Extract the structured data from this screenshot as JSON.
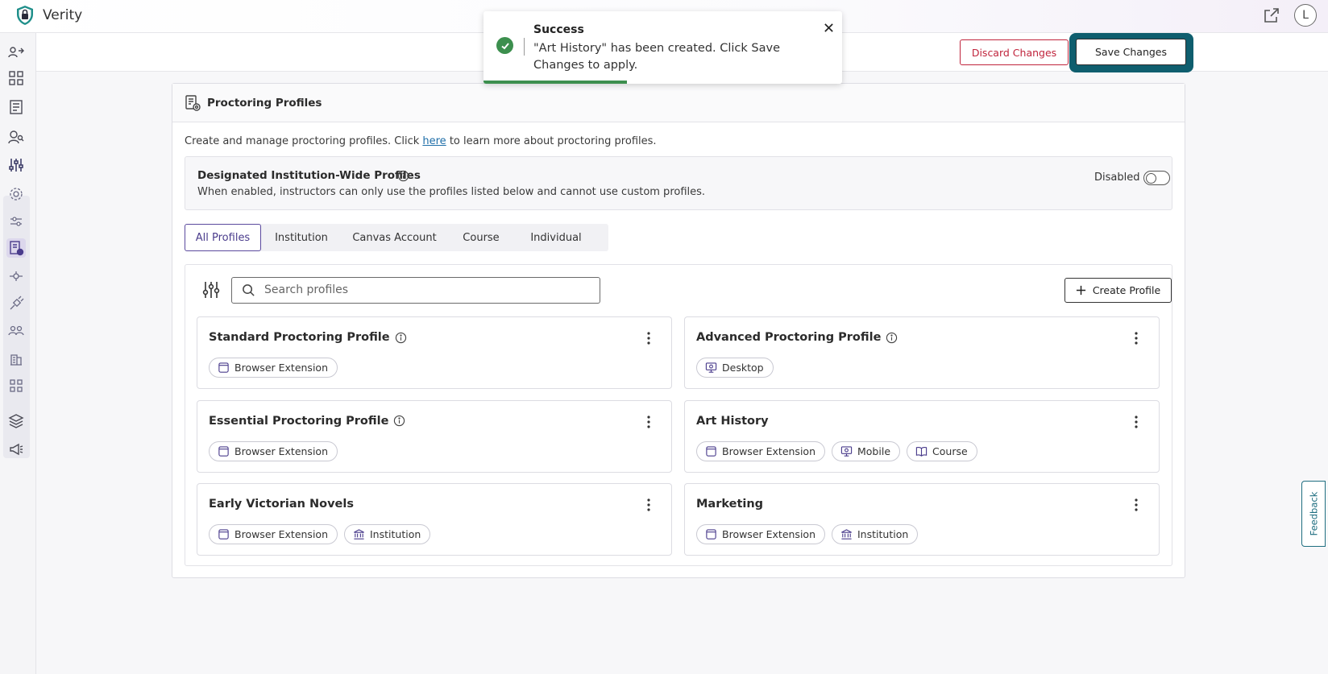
{
  "app": {
    "name": "Verity",
    "avatar_initial": "L"
  },
  "actions": {
    "discard_label": "Discard Changes",
    "save_label": "Save Changes"
  },
  "toast": {
    "title": "Success",
    "message": "\"Art History\" has been created. Click Save Changes to apply.",
    "progress": 0.4
  },
  "page": {
    "title": "Proctoring Profiles",
    "intro_before": "Create and manage proctoring profiles. Click ",
    "intro_link": "here",
    "intro_after": " to learn more about proctoring profiles."
  },
  "designated": {
    "title": "Designated Institution-Wide Profiles",
    "description": "When enabled, instructors can only use the profiles listed below and cannot use custom profiles.",
    "toggle_label": "Disabled",
    "enabled": false
  },
  "tabs": [
    {
      "label": "All Profiles",
      "active": true
    },
    {
      "label": "Institution",
      "active": false
    },
    {
      "label": "Canvas Account",
      "active": false
    },
    {
      "label": "Course",
      "active": false
    },
    {
      "label": "Individual",
      "active": false
    }
  ],
  "search": {
    "placeholder": "Search profiles"
  },
  "create_label": "Create Profile",
  "profiles": [
    {
      "name": "Standard Proctoring Profile",
      "info": true,
      "tags": [
        {
          "label": "Browser Extension",
          "icon": "browser-extension-icon"
        }
      ]
    },
    {
      "name": "Advanced Proctoring Profile",
      "info": true,
      "tags": [
        {
          "label": "Desktop",
          "icon": "desktop-icon"
        }
      ]
    },
    {
      "name": "Essential Proctoring Profile",
      "info": true,
      "tags": [
        {
          "label": "Browser Extension",
          "icon": "browser-extension-icon"
        }
      ]
    },
    {
      "name": "Art History",
      "info": false,
      "tags": [
        {
          "label": "Browser Extension",
          "icon": "browser-extension-icon"
        },
        {
          "label": "Mobile",
          "icon": "mobile-icon"
        },
        {
          "label": "Course",
          "icon": "course-icon"
        }
      ]
    },
    {
      "name": "Early Victorian Novels",
      "info": false,
      "tags": [
        {
          "label": "Browser Extension",
          "icon": "browser-extension-icon"
        },
        {
          "label": "Institution",
          "icon": "institution-icon"
        }
      ]
    },
    {
      "name": "Marketing",
      "info": false,
      "tags": [
        {
          "label": "Browser Extension",
          "icon": "browser-extension-icon"
        },
        {
          "label": "Institution",
          "icon": "institution-icon"
        }
      ]
    }
  ],
  "feedback_label": "Feedback",
  "colors": {
    "accent": "#4a3c8c",
    "danger": "#c0243c",
    "success": "#3c8f4e",
    "focus": "#0f5e6e"
  }
}
